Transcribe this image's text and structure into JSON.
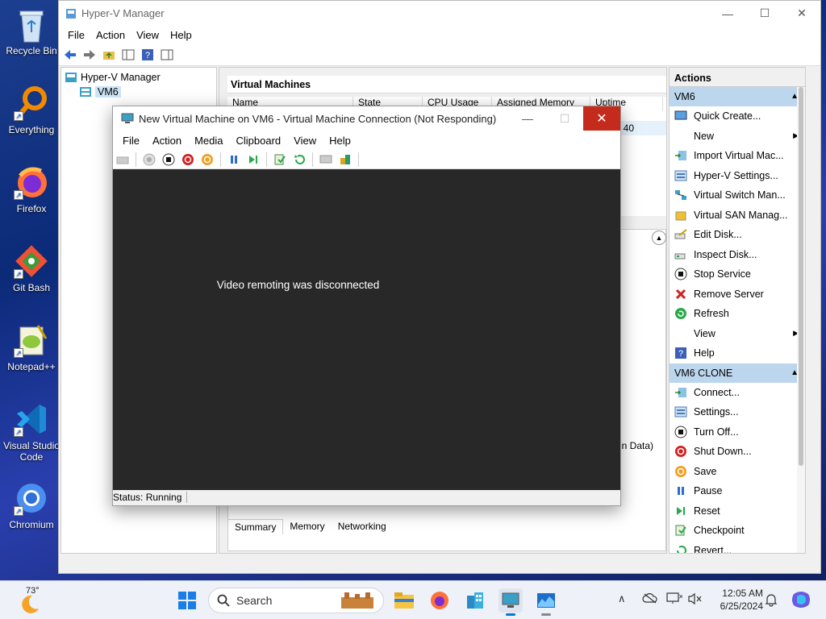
{
  "desktop": {
    "icons": [
      {
        "label": "Recycle Bin"
      },
      {
        "label": "Everything"
      },
      {
        "label": "Firefox"
      },
      {
        "label": "Git Bash"
      },
      {
        "label": "Notepad++"
      },
      {
        "label": "Visual Studio Code"
      },
      {
        "label": "Chromium"
      }
    ]
  },
  "hyperv": {
    "title": "Hyper-V Manager",
    "menu": [
      "File",
      "Action",
      "View",
      "Help"
    ],
    "tree": {
      "root": "Hyper-V Manager",
      "child": "VM6"
    },
    "vm_section_title": "Virtual Machines",
    "columns": [
      "Name",
      "State",
      "CPU Usage",
      "Assigned Memory",
      "Uptime"
    ],
    "row_fragment": "40",
    "detail_fragment": "n Data)",
    "tabs": [
      "Summary",
      "Memory",
      "Networking"
    ],
    "actions": {
      "title": "Actions",
      "group1": "VM6",
      "group1_items": [
        {
          "label": "Quick Create...",
          "icon": "quick-create-icon"
        },
        {
          "label": "New",
          "icon": "none",
          "submenu": true
        },
        {
          "label": "Import Virtual Mac...",
          "icon": "import-icon"
        },
        {
          "label": "Hyper-V Settings...",
          "icon": "settings-icon"
        },
        {
          "label": "Virtual Switch Man...",
          "icon": "switch-icon"
        },
        {
          "label": "Virtual SAN Manag...",
          "icon": "san-icon"
        },
        {
          "label": "Edit Disk...",
          "icon": "edit-disk-icon"
        },
        {
          "label": "Inspect Disk...",
          "icon": "inspect-disk-icon"
        },
        {
          "label": "Stop Service",
          "icon": "stop-icon"
        },
        {
          "label": "Remove Server",
          "icon": "remove-icon"
        },
        {
          "label": "Refresh",
          "icon": "refresh-icon"
        },
        {
          "label": "View",
          "icon": "none",
          "submenu": true
        },
        {
          "label": "Help",
          "icon": "help-icon"
        }
      ],
      "group2": "VM6 CLONE",
      "group2_items": [
        {
          "label": "Connect...",
          "icon": "connect-icon"
        },
        {
          "label": "Settings...",
          "icon": "settings-icon"
        },
        {
          "label": "Turn Off...",
          "icon": "turn-off-icon"
        },
        {
          "label": "Shut Down...",
          "icon": "shutdown-icon"
        },
        {
          "label": "Save",
          "icon": "save-icon"
        },
        {
          "label": "Pause",
          "icon": "pause-icon"
        },
        {
          "label": "Reset",
          "icon": "reset-icon"
        },
        {
          "label": "Checkpoint",
          "icon": "checkpoint-icon"
        },
        {
          "label": "Revert...",
          "icon": "revert-icon"
        }
      ]
    }
  },
  "vmconnect": {
    "title": "New Virtual Machine on VM6 - Virtual Machine Connection (Not Responding)",
    "menu": [
      "File",
      "Action",
      "Media",
      "Clipboard",
      "View",
      "Help"
    ],
    "message": "Video remoting was disconnected",
    "status": "Status: Running"
  },
  "taskbar": {
    "temperature": "73°",
    "search_placeholder": "Search",
    "time": "12:05 AM",
    "date": "6/25/2024"
  },
  "colors": {
    "accent": "#0078d4",
    "close_red": "#c42b1c",
    "selection": "#cce4f7",
    "actions_group": "#bcd6ee"
  }
}
